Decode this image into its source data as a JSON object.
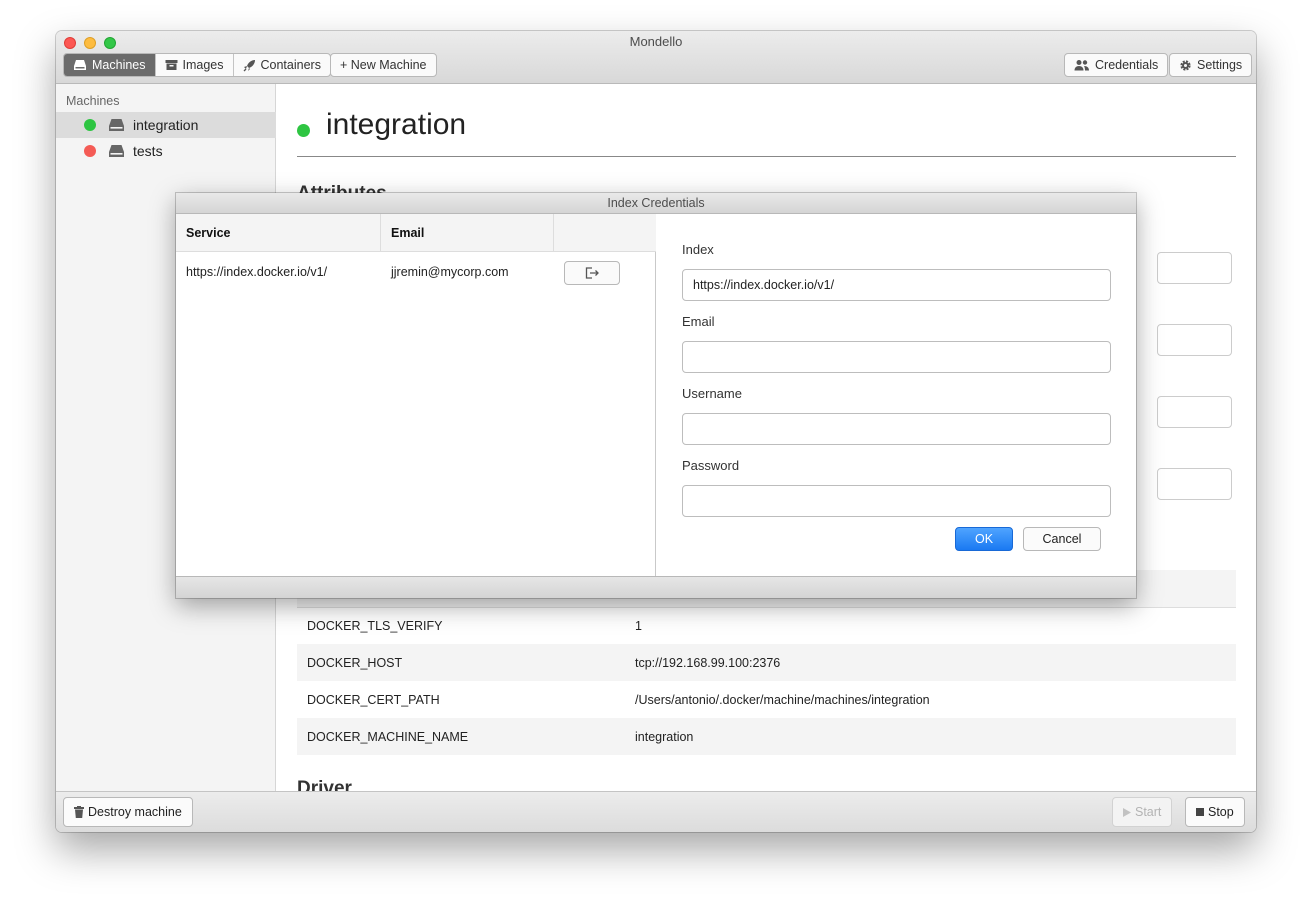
{
  "window": {
    "title": "Mondello"
  },
  "toolbar": {
    "tabs": [
      {
        "label": "Machines",
        "icon": "drive-icon",
        "active": true
      },
      {
        "label": "Images",
        "icon": "archive-icon",
        "active": false
      },
      {
        "label": "Containers",
        "icon": "rocket-icon",
        "active": false
      }
    ],
    "new_machine": "+ New Machine",
    "credentials": "Credentials",
    "settings": "Settings"
  },
  "sidebar": {
    "heading": "Machines",
    "items": [
      {
        "label": "integration",
        "status": "running",
        "status_color": "#2ec542",
        "selected": true
      },
      {
        "label": "tests",
        "status": "stopped",
        "status_color": "#f45b55",
        "selected": false
      }
    ]
  },
  "main": {
    "machine_name": "integration",
    "sections": {
      "attributes": "Attributes",
      "driver": "Driver"
    },
    "env": [
      {
        "key": "DOCKER_TLS_VERIFY",
        "value": "1"
      },
      {
        "key": "DOCKER_HOST",
        "value": "tcp://192.168.99.100:2376"
      },
      {
        "key": "DOCKER_CERT_PATH",
        "value": "/Users/antonio/.docker/machine/machines/integration"
      },
      {
        "key": "DOCKER_MACHINE_NAME",
        "value": "integration"
      }
    ]
  },
  "bottom": {
    "destroy": "Destroy machine",
    "start": "Start",
    "stop": "Stop"
  },
  "dialog": {
    "title": "Index Credentials",
    "columns": {
      "service": "Service",
      "email": "Email"
    },
    "rows": [
      {
        "service": "https://index.docker.io/v1/",
        "email": "jjremin@mycorp.com"
      }
    ],
    "form": {
      "index_label": "Index",
      "index_value": "https://index.docker.io/v1/",
      "email_label": "Email",
      "email_value": "",
      "username_label": "Username",
      "username_value": "",
      "password_label": "Password",
      "password_value": ""
    },
    "ok": "OK",
    "cancel": "Cancel"
  },
  "colors": {
    "accent": "#1a79f2",
    "running": "#2ec542",
    "stopped": "#f45b55"
  }
}
